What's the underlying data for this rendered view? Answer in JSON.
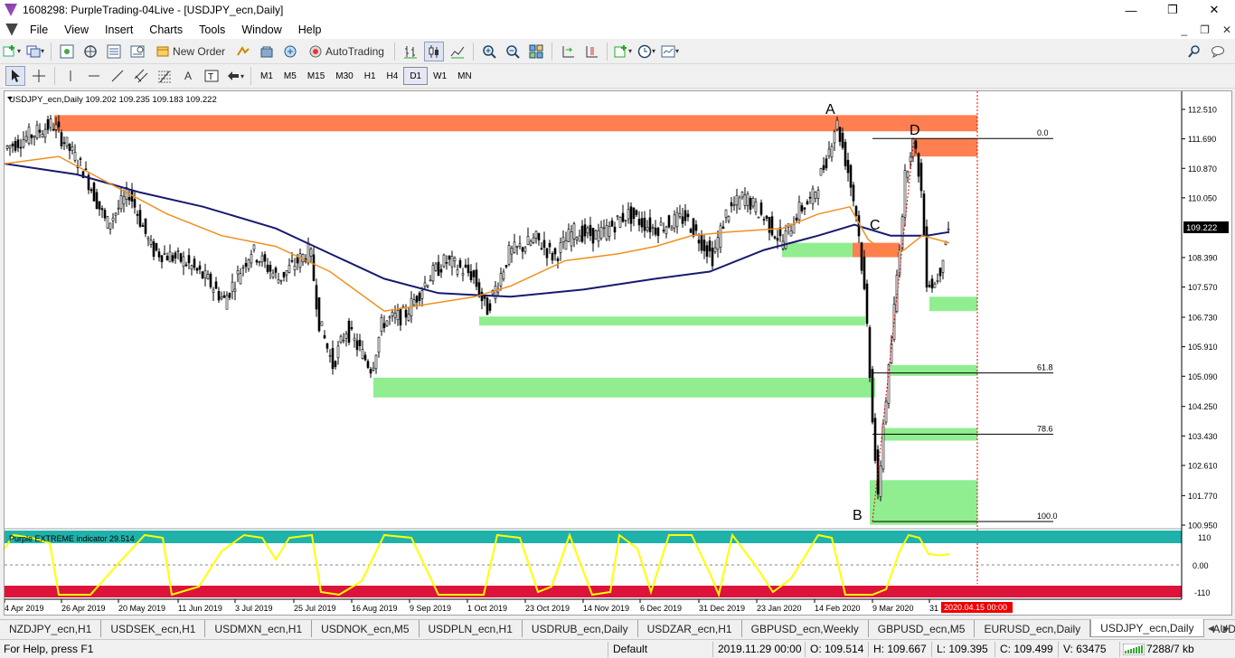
{
  "window": {
    "title": "1608298: PurpleTrading-04Live - [USDJPY_ecn,Daily]",
    "minimize": "—",
    "restore": "❐",
    "close": "✕"
  },
  "menu": {
    "items": [
      "File",
      "View",
      "Insert",
      "Charts",
      "Tools",
      "Window",
      "Help"
    ],
    "mdi_min": "_",
    "mdi_restore": "❐",
    "mdi_close": "✕"
  },
  "toolbar": {
    "new_order": "New Order",
    "auto_trading": "AutoTrading"
  },
  "timeframes": [
    "M1",
    "M5",
    "M15",
    "M30",
    "H1",
    "H4",
    "D1",
    "W1",
    "MN"
  ],
  "active_timeframe": "D1",
  "chart": {
    "info": "USDJPY_ecn,Daily  109.202 109.235 109.183 109.222",
    "current_price": "109.222",
    "price_labels": [
      "112.510",
      "111.690",
      "110.870",
      "110.050",
      "109.222",
      "108.390",
      "107.570",
      "106.730",
      "105.910",
      "105.090",
      "104.250",
      "103.430",
      "102.610",
      "101.770",
      "100.950"
    ],
    "date_labels": [
      "4 Apr 2019",
      "26 Apr 2019",
      "20 May 2019",
      "11 Jun 2019",
      "3 Jul 2019",
      "25 Jul 2019",
      "16 Aug 2019",
      "9 Sep 2019",
      "1 Oct 2019",
      "23 Oct 2019",
      "14 Nov 2019",
      "6 Dec 2019",
      "31 Dec 2019",
      "23 Jan 2020",
      "14 Feb 2020",
      "9 Mar 2020",
      "31"
    ],
    "date_cursor": "2020.04.15 00:00",
    "point_labels": [
      "A",
      "B",
      "C",
      "D"
    ],
    "fib_levels": [
      "0.0",
      "61.8",
      "78.6",
      "100.0"
    ],
    "indicator": {
      "name": "Purple EXTREME indicator 29.514",
      "levels": [
        "110",
        "0.00",
        "-110"
      ]
    },
    "colors": {
      "supply": "#ff7f50",
      "demand": "#90ee90",
      "ma_fast": "#f0901e",
      "ma_slow": "#191970",
      "indicator_line": "#ffff00",
      "indicator_top": "#20b2aa",
      "indicator_bottom": "#dc143c"
    }
  },
  "tabs": [
    "NZDJPY_ecn,H1",
    "USDSEK_ecn,H1",
    "USDMXN_ecn,H1",
    "USDNOK_ecn,M5",
    "USDPLN_ecn,H1",
    "USDRUB_ecn,Daily",
    "USDZAR_ecn,H1",
    "GBPUSD_ecn,Weekly",
    "GBPUSD_ecn,M5",
    "EURUSD_ecn,Daily",
    "USDJPY_ecn,Daily",
    "AUDUSD_e"
  ],
  "active_tab": "USDJPY_ecn,Daily",
  "status": {
    "help": "For Help, press F1",
    "profile": "Default",
    "datetime": "2019.11.29 00:00",
    "open": "O: 109.514",
    "high": "H: 109.667",
    "low": "L: 109.395",
    "close": "C: 109.499",
    "volume": "V: 63475",
    "traffic": "7288/7 kb"
  }
}
